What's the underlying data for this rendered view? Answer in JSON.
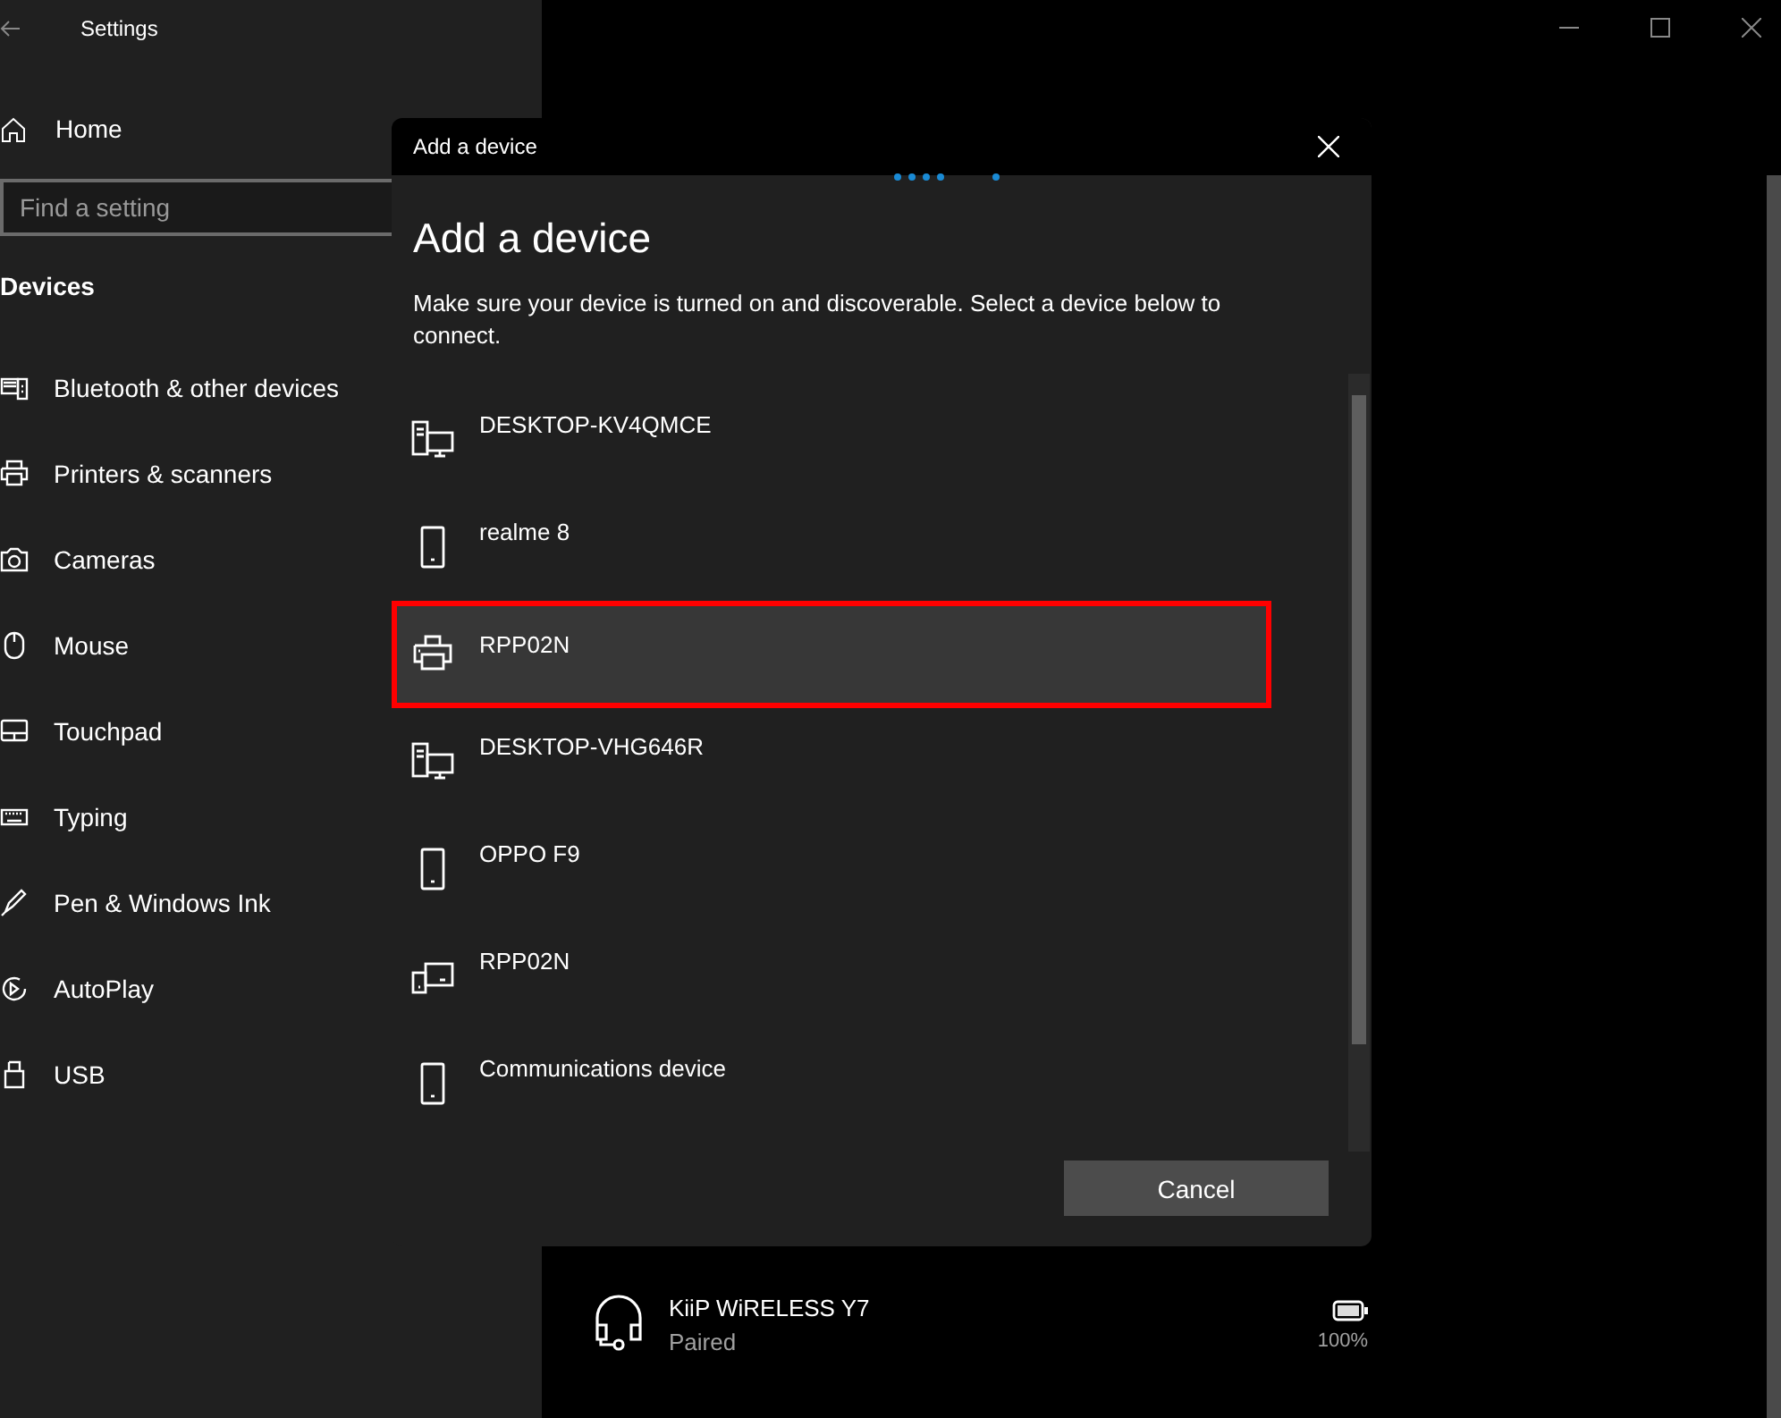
{
  "window": {
    "title": "Settings"
  },
  "sidebar": {
    "home": "Home",
    "search": {
      "placeholder": "Find a setting"
    },
    "section": "Devices",
    "items": [
      {
        "label": "Bluetooth & other devices",
        "kind": "bluetooth"
      },
      {
        "label": "Printers & scanners",
        "kind": "printer"
      },
      {
        "label": "Cameras",
        "kind": "camera"
      },
      {
        "label": "Mouse",
        "kind": "mouse"
      },
      {
        "label": "Touchpad",
        "kind": "touchpad"
      },
      {
        "label": "Typing",
        "kind": "keyboard"
      },
      {
        "label": "Pen & Windows Ink",
        "kind": "pen"
      },
      {
        "label": "AutoPlay",
        "kind": "autoplay"
      },
      {
        "label": "USB",
        "kind": "usb"
      }
    ]
  },
  "paired_device": {
    "name": "KiiP WiRELESS Y7",
    "status": "Paired",
    "battery": "100%"
  },
  "dialog": {
    "title": "Add a device",
    "heading": "Add a device",
    "description": "Make sure your device is turned on and discoverable. Select a device below to connect.",
    "devices": [
      {
        "name": "DESKTOP-KV4QMCE",
        "kind": "desktop",
        "selected": false
      },
      {
        "name": "realme 8",
        "kind": "phone",
        "selected": false
      },
      {
        "name": "RPP02N",
        "kind": "printer",
        "selected": true
      },
      {
        "name": "DESKTOP-VHG646R",
        "kind": "desktop",
        "selected": false
      },
      {
        "name": "OPPO F9",
        "kind": "phone",
        "selected": false
      },
      {
        "name": "RPP02N",
        "kind": "devices",
        "selected": false
      },
      {
        "name": "Communications device",
        "kind": "phone",
        "selected": false
      }
    ],
    "button": "Cancel"
  }
}
